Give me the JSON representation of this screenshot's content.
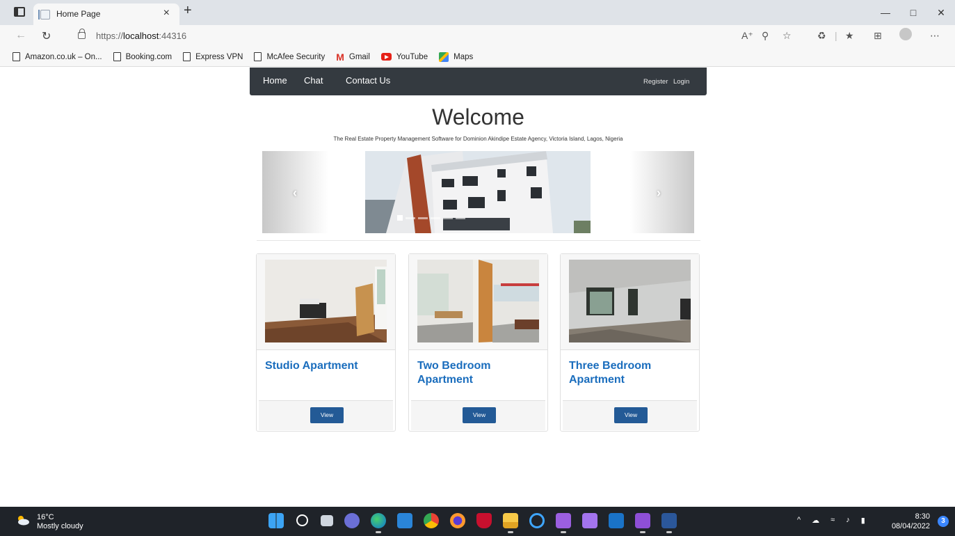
{
  "browser": {
    "tab_title": "Home Page",
    "tab_close": "×",
    "new_tab": "+",
    "url_prefix": "https://",
    "url_host": "localhost",
    "url_port": ":44316",
    "bookmarks": [
      {
        "label": "Amazon.co.uk – On...",
        "icon": "page-icon"
      },
      {
        "label": "Booking.com",
        "icon": "page-icon"
      },
      {
        "label": "Express VPN",
        "icon": "page-icon"
      },
      {
        "label": "McAfee Security",
        "icon": "page-icon"
      },
      {
        "label": "Gmail",
        "icon": "gmail-icon"
      },
      {
        "label": "YouTube",
        "icon": "youtube-icon"
      },
      {
        "label": "Maps",
        "icon": "maps-icon"
      }
    ]
  },
  "site": {
    "nav": {
      "home": "Home",
      "chat": "Chat",
      "contact": "Contact Us",
      "register": "Register",
      "login": "Login"
    },
    "welcome": "Welcome",
    "subtitle": "The Real Estate Property Management Software for Dominion Akindipe Estate Agency, Victoria Island, Lagos, Nigeria",
    "carousel": {
      "prev": "‹",
      "next": "›",
      "slide_count": 6,
      "active_slide": 1
    },
    "cards": [
      {
        "title": "Studio Apartment",
        "button": "View"
      },
      {
        "title": "Two Bedroom Apartment",
        "button": "View"
      },
      {
        "title": "Three Bedroom Apartment",
        "button": "View"
      }
    ]
  },
  "taskbar": {
    "temperature": "16°C",
    "weather": "Mostly cloudy",
    "time": "8:30",
    "date": "08/04/2022",
    "notifications": "3"
  },
  "colors": {
    "nav_bg": "#343a40",
    "card_title": "#1a6dbd",
    "button_bg": "#235a96",
    "taskbar_bg": "#1f2329"
  }
}
